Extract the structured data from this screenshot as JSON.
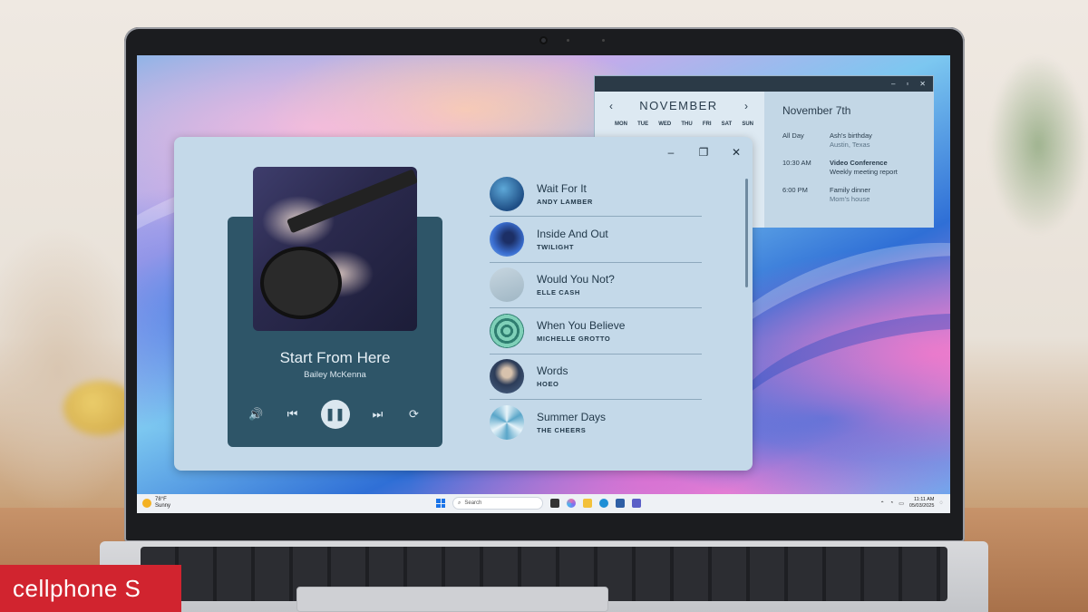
{
  "calendar": {
    "month": "NOVEMBER",
    "prev": "‹",
    "next": "›",
    "weekdays": [
      "MON",
      "TUE",
      "WED",
      "THU",
      "FRI",
      "SAT",
      "SUN"
    ],
    "title_controls": [
      "–",
      "▫",
      "✕"
    ],
    "selected_date": "November 7th",
    "events": [
      {
        "time": "All Day",
        "title": "Ash's birthday",
        "sub": "Austin, Texas"
      },
      {
        "time": "10:30 AM",
        "title": "Video Conference",
        "sub": "Weekly meeting report"
      },
      {
        "time": "6:00 PM",
        "title": "Family dinner",
        "sub": "Mom's house"
      }
    ]
  },
  "player": {
    "window_controls": {
      "minimize": "–",
      "restore": "❐",
      "close": "✕"
    },
    "now_playing": {
      "title": "Start From Here",
      "artist": "Bailey McKenna"
    },
    "controls": {
      "volume": "🔊",
      "prev": "⏮",
      "play_pause": "❚❚",
      "next": "⏭",
      "repeat": "⟳"
    },
    "playlist": [
      {
        "song": "Wait For It",
        "artist": "ANDY LAMBER",
        "color": "#1f4f86"
      },
      {
        "song": "Inside And Out",
        "artist": "TWILIGHT",
        "color": "#3a6ed0"
      },
      {
        "song": "Would You Not?",
        "artist": "ELLE CASH",
        "color": "#a9bfcc"
      },
      {
        "song": "When You Believe",
        "artist": "MICHELLE GROTTO",
        "color": "#3c8f7e"
      },
      {
        "song": "Words",
        "artist": "HOEO",
        "color": "#2c3c58"
      },
      {
        "song": "Summer Days",
        "artist": "THE CHEERS",
        "color": "#5aa6c9"
      }
    ]
  },
  "taskbar": {
    "weather_temp": "78°F",
    "weather_desc": "Sunny",
    "search_placeholder": "Search",
    "time": "11:11 AM",
    "date": "05/03/2025"
  },
  "brand": {
    "logo_text": "cellphone S"
  },
  "colors": {
    "accent": "#2e5568",
    "window_bg": "#c4d9e9",
    "brand_red": "#d1242f"
  }
}
